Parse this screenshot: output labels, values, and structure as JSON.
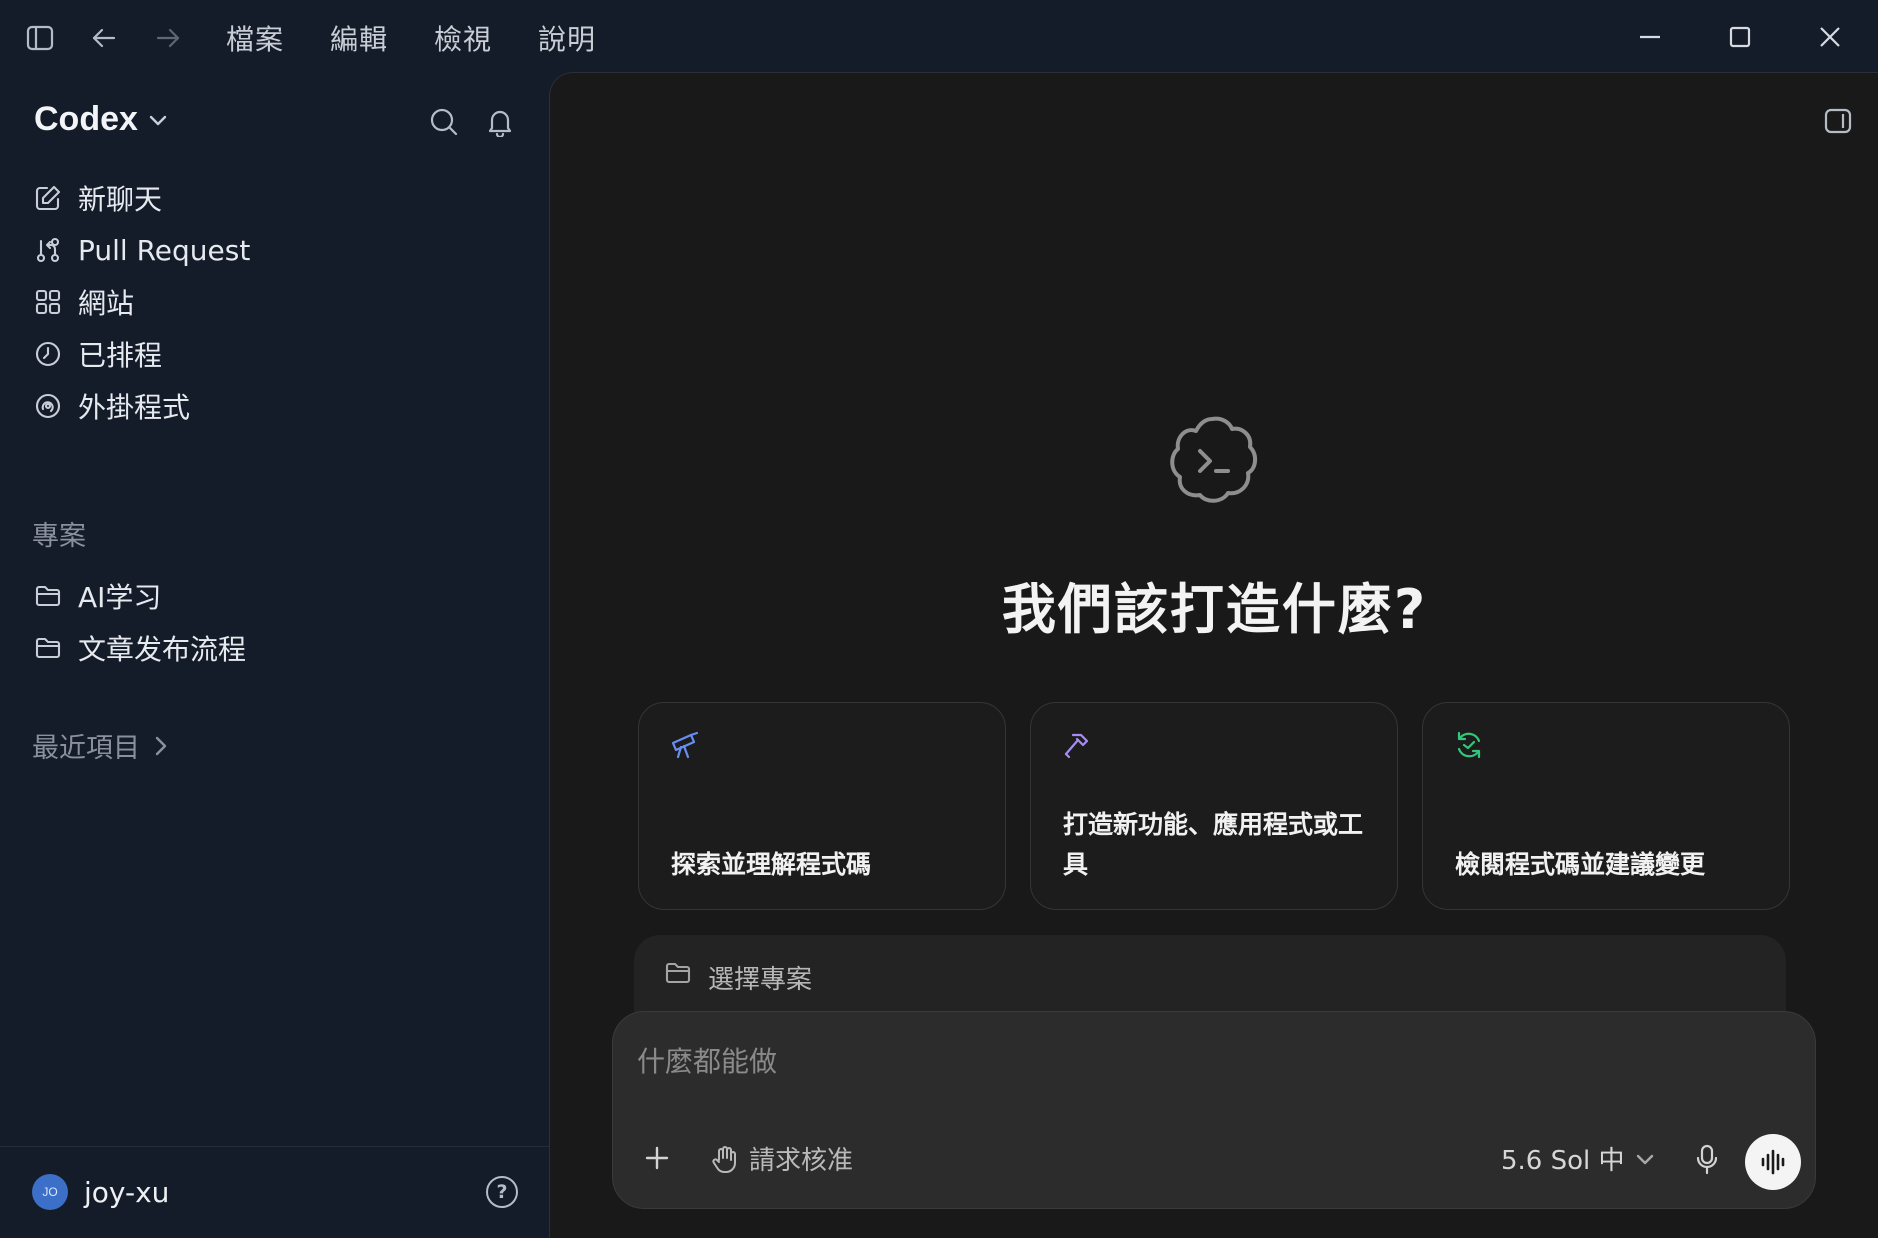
{
  "titlebar": {
    "menus": [
      "檔案",
      "編輯",
      "檢視",
      "說明"
    ]
  },
  "sidebar": {
    "brand": "Codex",
    "nav": [
      {
        "label": "新聊天",
        "icon": "edit-icon"
      },
      {
        "label": "Pull Request",
        "icon": "git-pull-request-icon"
      },
      {
        "label": "網站",
        "icon": "grid-icon"
      },
      {
        "label": "已排程",
        "icon": "clock-icon"
      },
      {
        "label": "外掛程式",
        "icon": "plugin-icon"
      }
    ],
    "projects_title": "專案",
    "projects": [
      {
        "label": "AI学习",
        "icon": "folder-icon"
      },
      {
        "label": "文章发布流程",
        "icon": "folder-icon"
      }
    ],
    "recent_label": "最近項目",
    "user": {
      "initials": "JO",
      "name": "joy-xu"
    },
    "help_label": "?"
  },
  "main": {
    "title": "我們該打造什麼?",
    "cards": [
      {
        "label": "探索並理解程式碼",
        "icon": "telescope-icon",
        "color": "#6a8df0"
      },
      {
        "label": "打造新功能、應用程式或工具",
        "icon": "hammer-icon",
        "color": "#a78bfa"
      },
      {
        "label": "檢閱程式碼並建議變更",
        "icon": "refresh-check-icon",
        "color": "#34c77b"
      }
    ],
    "project_select": "選擇專案",
    "composer": {
      "placeholder": "什麼都能做",
      "approval": "請求核准",
      "model": "5.6 Sol 中"
    }
  }
}
